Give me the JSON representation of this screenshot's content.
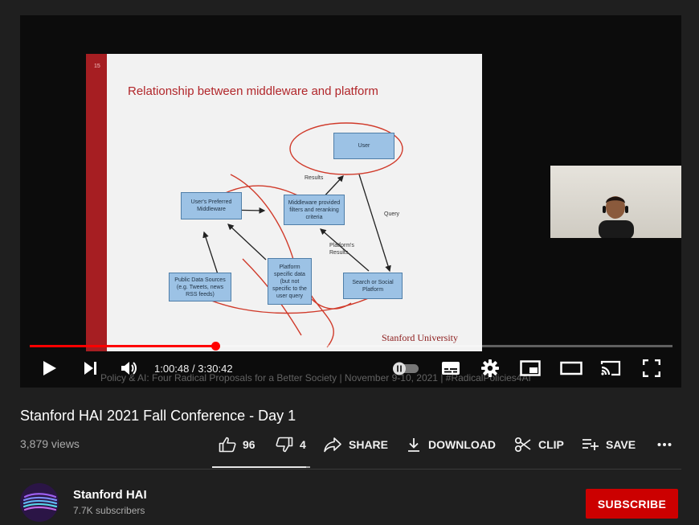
{
  "player": {
    "current_time": "1:00:48",
    "duration": "3:30:42",
    "time_separator": " / ",
    "progress_fraction": 0.289,
    "autoplay_on": false,
    "caption_strip": "Policy & AI: Four Radical Proposals for a Better Society   |   November 9-10, 2021   |   #RadicalPolicies4AI"
  },
  "slide": {
    "number": "15",
    "title": "Relationship between middleware and platform",
    "footer": "Stanford University",
    "boxes": {
      "user": "User",
      "preferred": "User's Preferred Middleware",
      "middleware": "Middleware provided filters and reranking criteria",
      "public": "Public Data Sources (e.g. Tweets, news RSS feeds)",
      "platform_data": "Platform specific data (but not specific to the user query",
      "search": "Search or Social Platform"
    },
    "labels": {
      "results": "Results",
      "query": "Query",
      "platform_results": "Platform's Results"
    }
  },
  "video": {
    "title": "Stanford HAI 2021 Fall Conference - Day 1",
    "views": "3,879 views"
  },
  "actions": {
    "likes": "96",
    "dislikes": "4",
    "share": "SHARE",
    "download": "DOWNLOAD",
    "clip": "CLIP",
    "save": "SAVE",
    "like_ratio": 0.96
  },
  "channel": {
    "name": "Stanford HAI",
    "subscribers": "7.7K subscribers",
    "subscribe_label": "SUBSCRIBE"
  },
  "colors": {
    "accent_red": "#ff0000",
    "subscribe_red": "#cc0000",
    "slide_title_red": "#b1262a",
    "diagram_box_blue": "#9cc2e5"
  }
}
